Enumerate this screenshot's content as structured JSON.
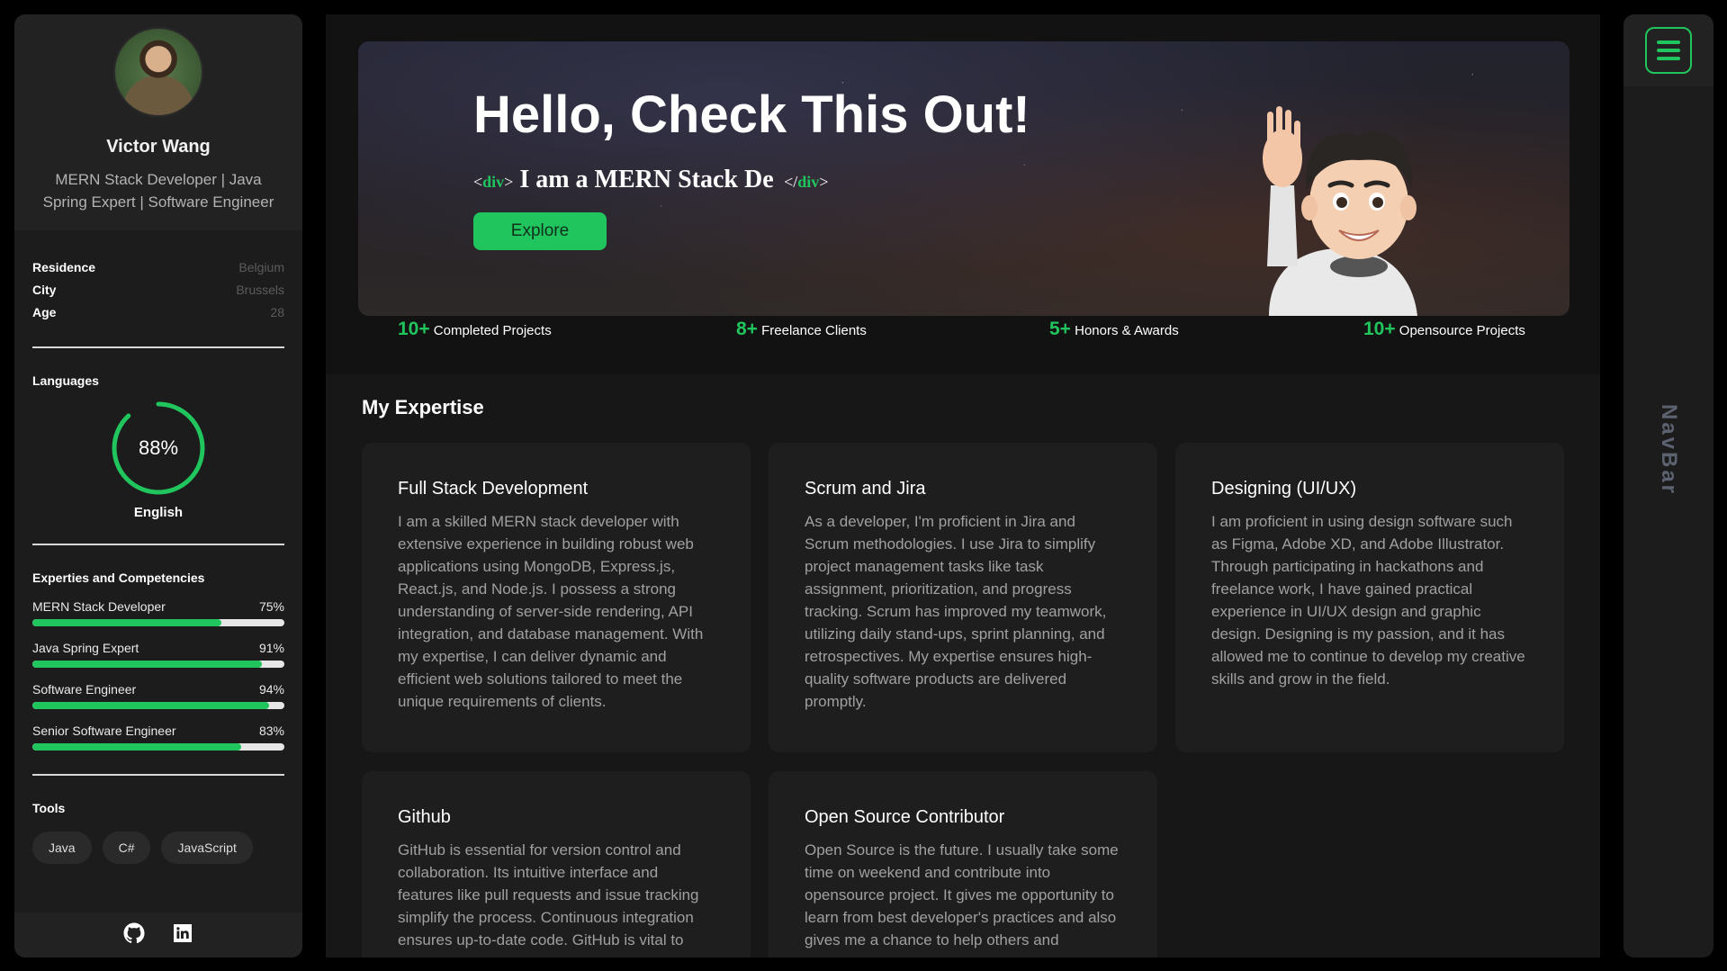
{
  "profile": {
    "name": "Victor Wang",
    "role": "MERN Stack Developer | Java Spring Expert | Software Engineer"
  },
  "info": [
    {
      "label": "Residence",
      "value": "Belgium"
    },
    {
      "label": "City",
      "value": "Brussels"
    },
    {
      "label": "Age",
      "value": "28"
    }
  ],
  "languages": {
    "title": "Languages",
    "items": [
      {
        "name": "English",
        "percent_label": "88%",
        "percent": 88
      }
    ]
  },
  "skills": {
    "title": "Experties and Competencies",
    "items": [
      {
        "name": "MERN Stack Developer",
        "percent_label": "75%",
        "percent": 75
      },
      {
        "name": "Java Spring Expert",
        "percent_label": "91%",
        "percent": 91
      },
      {
        "name": "Software Engineer",
        "percent_label": "94%",
        "percent": 94
      },
      {
        "name": "Senior Software Engineer",
        "percent_label": "83%",
        "percent": 83
      }
    ]
  },
  "tools": {
    "title": "Tools",
    "items": [
      "Java",
      "C#",
      "JavaScript"
    ]
  },
  "social": [
    "github-icon",
    "linkedin-icon"
  ],
  "hero": {
    "title": "Hello, Check This Out!",
    "tag_open_bracket": "<",
    "tag_open_name": "div",
    "tag_open_close": ">",
    "typed_text": "I am a MERN Stack De",
    "tag_close_bracket": "</",
    "tag_close_name": "div",
    "tag_close_end": ">",
    "button_label": "Explore"
  },
  "stats": [
    {
      "number": "10+",
      "label": "Completed Projects"
    },
    {
      "number": "8+",
      "label": "Freelance Clients"
    },
    {
      "number": "5+",
      "label": "Honors & Awards"
    },
    {
      "number": "10+",
      "label": "Opensource Projects"
    }
  ],
  "expertise": {
    "title": "My Expertise",
    "cards": [
      {
        "title": "Full Stack Development",
        "text": "I am a skilled MERN stack developer with extensive experience in building robust web applications using MongoDB, Express.js, React.js, and Node.js. I possess a strong understanding of server-side rendering, API integration, and database management. With my expertise, I can deliver dynamic and efficient web solutions tailored to meet the unique requirements of clients."
      },
      {
        "title": "Scrum and Jira",
        "text": "As a developer, I'm proficient in Jira and Scrum methodologies. I use Jira to simplify project management tasks like task assignment, prioritization, and progress tracking. Scrum has improved my teamwork, utilizing daily stand-ups, sprint planning, and retrospectives. My expertise ensures high-quality software products are delivered promptly."
      },
      {
        "title": "Designing (UI/UX)",
        "text": "I am proficient in using design software such as Figma, Adobe XD, and Adobe Illustrator. Through participating in hackathons and freelance work, I have gained practical experience in UI/UX design and graphic design. Designing is my passion, and it has allowed me to continue to develop my creative skills and grow in the field."
      },
      {
        "title": "Github",
        "text": "GitHub is essential for version control and collaboration. Its intuitive interface and features like pull requests and issue tracking simplify the process. Continuous integration ensures up-to-date code. GitHub is vital to"
      },
      {
        "title": "Open Source Contributor",
        "text": "Open Source is the future. I usually take some time on weekend and contribute into opensource project. It gives me opportunity to learn from best developer's practices and also gives me a chance to help others and"
      }
    ]
  },
  "nav": {
    "label": "NavBar",
    "menu_icon": "hamburger-menu-icon"
  },
  "colors": {
    "accent": "#21c55d",
    "background": "#000000",
    "panel": "#1c1c1c",
    "card": "#1e1e1e"
  }
}
